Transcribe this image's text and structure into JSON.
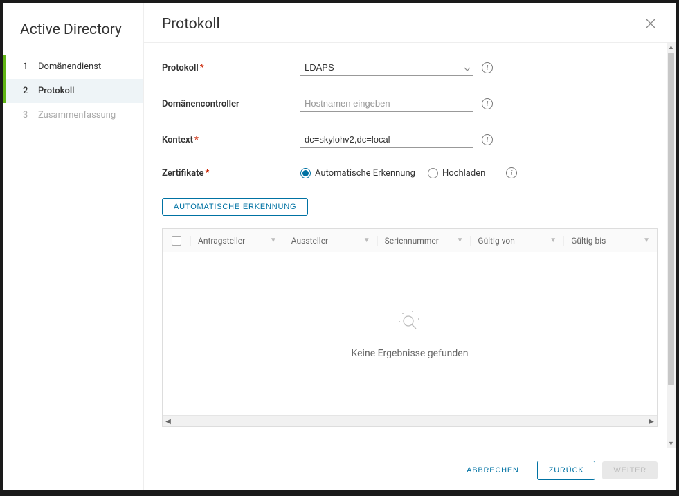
{
  "sidebar": {
    "title": "Active Directory",
    "steps": [
      {
        "num": "1",
        "label": "Domänendienst",
        "state": "completed"
      },
      {
        "num": "2",
        "label": "Protokoll",
        "state": "active"
      },
      {
        "num": "3",
        "label": "Zusammenfassung",
        "state": "disabled"
      }
    ]
  },
  "main": {
    "title": "Protokoll",
    "form": {
      "protocol": {
        "label": "Protokoll",
        "required": true,
        "value": "LDAPS"
      },
      "dc": {
        "label": "Domänencontroller",
        "placeholder": "Hostnamen eingeben",
        "value": ""
      },
      "context": {
        "label": "Kontext",
        "required": true,
        "value": "dc=skylohv2,dc=local"
      },
      "certs": {
        "label": "Zertifikate",
        "required": true,
        "options": [
          {
            "label": "Automatische Erkennung",
            "checked": true
          },
          {
            "label": "Hochladen",
            "checked": false
          }
        ]
      },
      "auto_detect_button": "Automatische Erkennung"
    },
    "table": {
      "columns": [
        "Antragsteller",
        "Aussteller",
        "Seriennummer",
        "Gültig von",
        "Gültig bis"
      ],
      "empty_text": "Keine Ergebnisse gefunden"
    }
  },
  "footer": {
    "cancel": "Abbrechen",
    "back": "Zurück",
    "next": "Weiter"
  }
}
